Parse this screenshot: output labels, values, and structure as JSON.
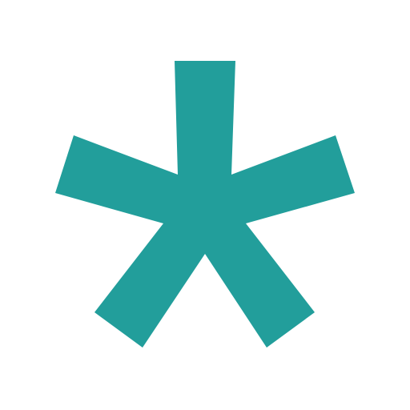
{
  "icon": {
    "name": "asterisk-icon",
    "color": "#229e9b",
    "background": "#ffffff"
  }
}
